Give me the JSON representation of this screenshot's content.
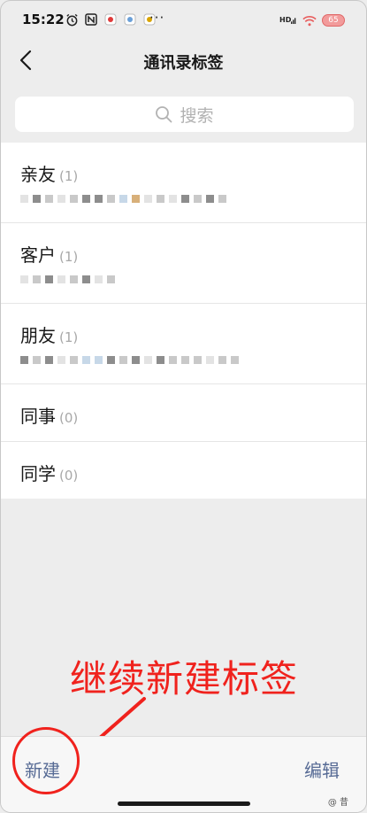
{
  "status_bar": {
    "time": "15:22",
    "dots": "···",
    "hd": "HD",
    "battery": "65"
  },
  "header": {
    "title": "通讯录标签"
  },
  "search": {
    "placeholder": "搜索"
  },
  "tags": [
    {
      "name": "亲友",
      "count": "(1)"
    },
    {
      "name": "客户",
      "count": "(1)"
    },
    {
      "name": "朋友",
      "count": "(1)"
    },
    {
      "name": "同事",
      "count": "(0)"
    },
    {
      "name": "同学",
      "count": "(0)"
    }
  ],
  "annotation": {
    "text": "继续新建标签",
    "color": "#f0221d"
  },
  "bottom_bar": {
    "new_label": "新建",
    "edit_label": "编辑"
  },
  "watermark": "@ 昔"
}
